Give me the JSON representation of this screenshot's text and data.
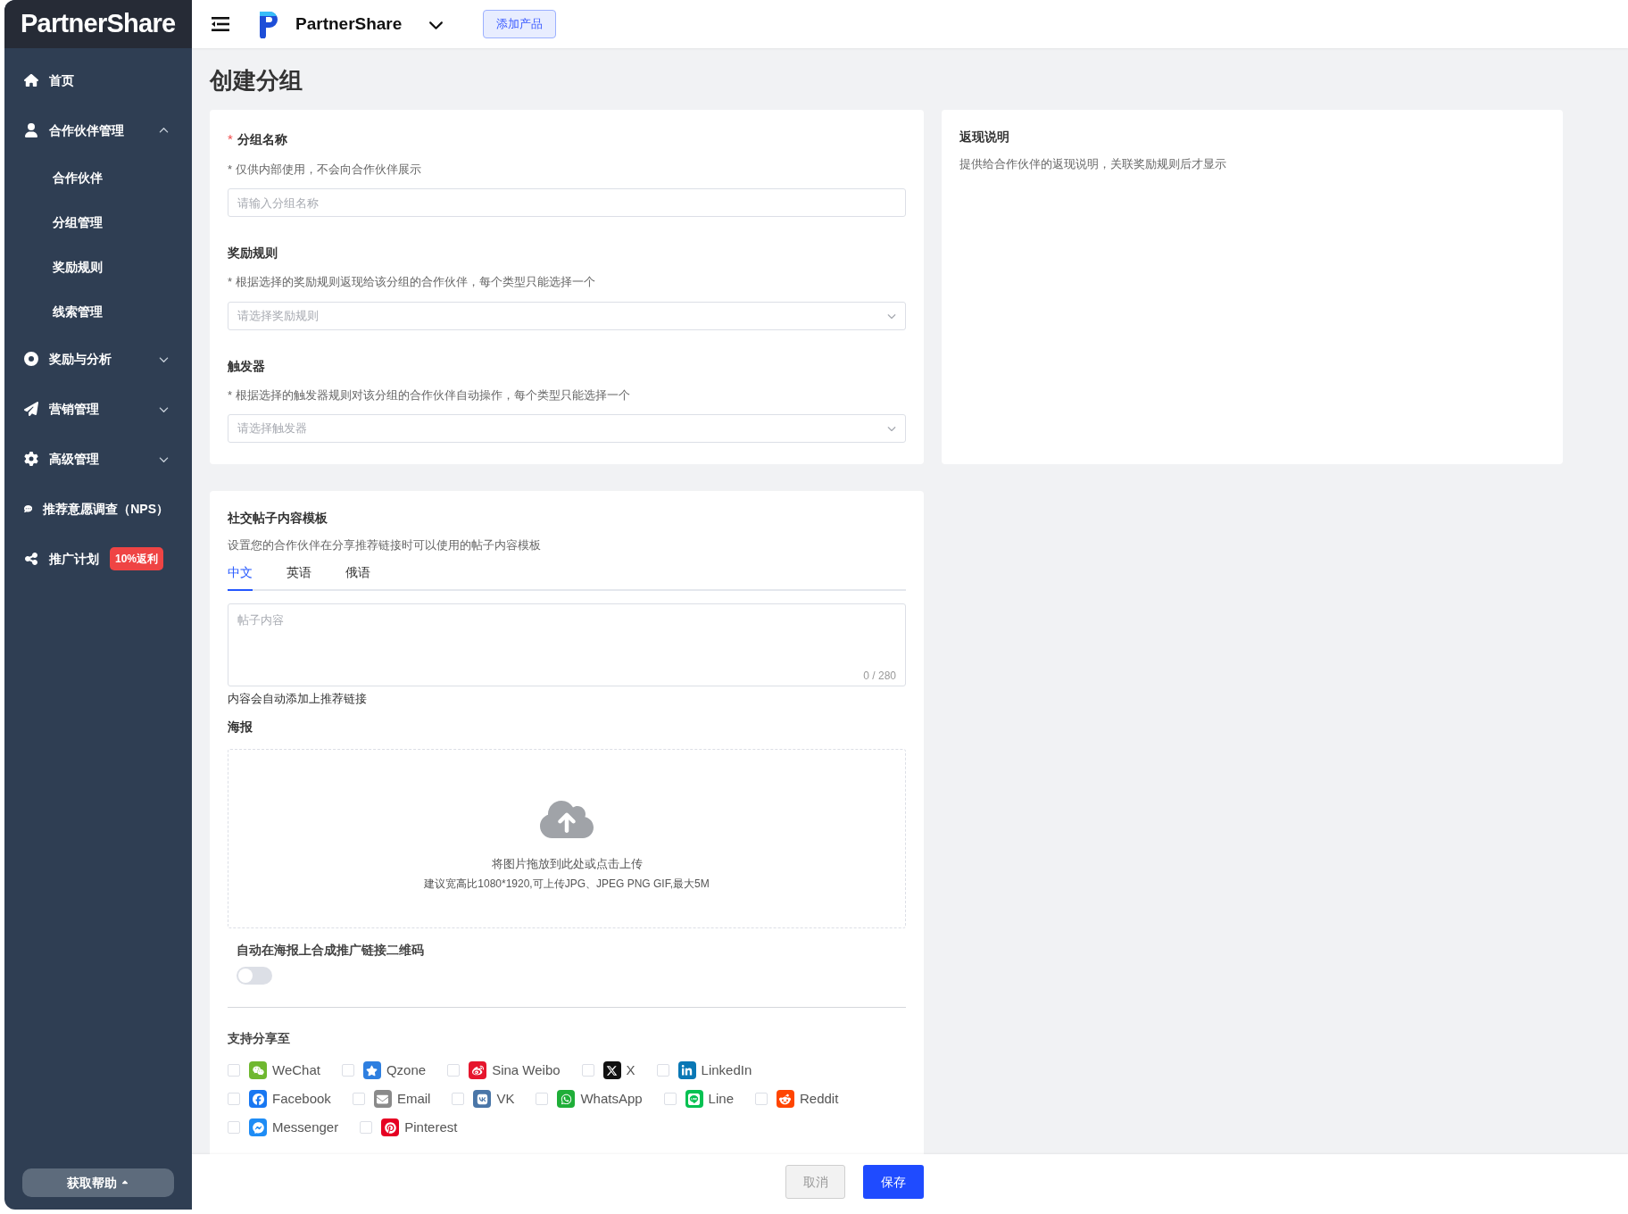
{
  "sidebar": {
    "logo": "PartnerShare",
    "items": [
      {
        "label": "首页",
        "kind": "link"
      },
      {
        "label": "合作伙伴管理",
        "kind": "group",
        "expanded": true,
        "children": [
          {
            "label": "合作伙伴"
          },
          {
            "label": "分组管理"
          },
          {
            "label": "奖励规则"
          },
          {
            "label": "线索管理"
          }
        ]
      },
      {
        "label": "奖励与分析",
        "kind": "group",
        "expanded": false
      },
      {
        "label": "营销管理",
        "kind": "group",
        "expanded": false
      },
      {
        "label": "高级管理",
        "kind": "group",
        "expanded": false
      },
      {
        "label": "推荐意愿调查（NPS）",
        "kind": "link"
      },
      {
        "label": "推广计划",
        "kind": "link",
        "badge": "10%返利"
      }
    ],
    "help_button": "获取帮助"
  },
  "topbar": {
    "product": "PartnerShare",
    "add_button": "添加产品"
  },
  "page_title": "创建分组",
  "group_card": {
    "fields": [
      {
        "required_mark": "*",
        "label": "分组名称",
        "hint": "* 仅供内部使用，不会向合作伙伴展示",
        "kind": "input",
        "placeholder": "请输入分组名称"
      },
      {
        "label": "奖励规则",
        "hint": "* 根据选择的奖励规则返现给该分组的合作伙伴，每个类型只能选择一个",
        "kind": "select",
        "placeholder": "请选择奖励规则"
      },
      {
        "label": "触发器",
        "hint": "* 根据选择的触发器规则对该分组的合作伙伴自动操作，每个类型只能选择一个",
        "kind": "select",
        "placeholder": "请选择触发器"
      }
    ]
  },
  "cashback_card": {
    "title": "返现说明",
    "text": "提供给合作伙伴的返现说明，关联奖励规则后才显示"
  },
  "social_card": {
    "title": "社交帖子内容模板",
    "description": "设置您的合作伙伴在分享推荐链接时可以使用的帖子内容模板",
    "tabs": [
      {
        "label": "中文",
        "selected": true
      },
      {
        "label": "英语",
        "selected": false
      },
      {
        "label": "俄语",
        "selected": false
      }
    ],
    "post_placeholder": "帖子内容",
    "counter": "0 / 280",
    "post_note": "内容会自动添加上推荐链接",
    "poster_label": "海报",
    "upload_text": "将图片拖放到此处或点击上传",
    "upload_hint": "建议宽高比1080*1920,可上传JPG、JPEG PNG GIF,最大5M",
    "qr_toggle": {
      "label": "自动在海报上合成推广链接二维码",
      "on": false
    },
    "share_label": "支持分享至",
    "share_rows": [
      [
        {
          "label": "WeChat",
          "kind": "wechat",
          "color": "#6fb82f",
          "checked": false
        },
        {
          "label": "Qzone",
          "kind": "qzone",
          "color": "#2e7fe0",
          "checked": false
        },
        {
          "label": "Sina Weibo",
          "kind": "weibo",
          "color": "#e6162d",
          "checked": false
        },
        {
          "label": "X",
          "kind": "x",
          "color": "#111111",
          "checked": false
        },
        {
          "label": "LinkedIn",
          "kind": "linkedin",
          "color": "#0a78b5",
          "checked": false
        }
      ],
      [
        {
          "label": "Facebook",
          "kind": "facebook",
          "color": "#1877f2",
          "checked": false
        },
        {
          "label": "Email",
          "kind": "email",
          "color": "#8a8a8a",
          "checked": false
        },
        {
          "label": "VK",
          "kind": "vk",
          "color": "#4a76a8",
          "checked": false
        },
        {
          "label": "WhatsApp",
          "kind": "whatsapp",
          "color": "#1fae38",
          "checked": false
        },
        {
          "label": "Line",
          "kind": "line",
          "color": "#06c152",
          "checked": false
        },
        {
          "label": "Reddit",
          "kind": "reddit",
          "color": "#ff4500",
          "checked": false
        }
      ],
      [
        {
          "label": "Messenger",
          "kind": "messenger",
          "color": "#1e8cf5",
          "checked": false
        },
        {
          "label": "Pinterest",
          "kind": "pinterest",
          "color": "#e60023",
          "checked": false
        }
      ]
    ]
  },
  "footer": {
    "cancel": "取消",
    "save": "保存"
  }
}
